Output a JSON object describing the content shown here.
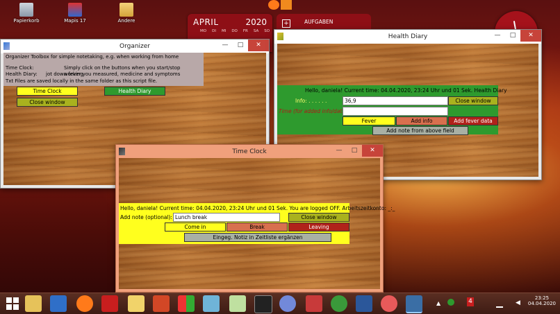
{
  "desktop": {
    "icons": [
      {
        "label": "Papierkorb"
      },
      {
        "label": "Mapis 17"
      },
      {
        "label": "Andere"
      }
    ],
    "calendar": {
      "month": "APRIL",
      "year": "2020",
      "days": [
        "MO",
        "DI",
        "MI",
        "DO",
        "FR",
        "SA",
        "SO"
      ]
    },
    "todo": {
      "label": "AUFGABEN",
      "plus": "+"
    }
  },
  "organizer": {
    "title": "Organizer",
    "controls": {
      "minimize": "—",
      "maximize": "□",
      "close": "✕"
    },
    "info": {
      "line1": "Organizer Toolbox for simple notetaking, e.g. when working from home",
      "line2_label": "Time Clock:",
      "line2_text": "Simply click on the buttons when you start/stop working.",
      "line3_label": "Health Diary:",
      "line3_text": "jot down fever you measured, medicine and symptoms",
      "line4": "Txt Files are saved locally in the same folder as this script file."
    },
    "buttons": {
      "time_clock": "Time Clock",
      "close_window": "Close window",
      "health_diary": "Health Diary"
    }
  },
  "health": {
    "title": "Health Diary",
    "controls": {
      "minimize": "—",
      "maximize": "□",
      "close": "✕"
    },
    "greeting": "Hello, daniela! Current time:  04.04.2020, 23:24 Uhr und 01 Sek. Health Diary",
    "info_label": "Info: . . . . . .",
    "info_value": "36,9",
    "time_label": "Time (for added info/data):",
    "time_value": "",
    "buttons": {
      "close_window": "Close window",
      "fever": "Fever",
      "add_info": "Add info",
      "add_fever_data": "Add fever data",
      "add_note": "Add note from above field"
    }
  },
  "timeclock": {
    "title": "Time Clock",
    "controls": {
      "minimize": "—",
      "maximize": "□",
      "close": "✕"
    },
    "greeting": "Hello, daniela! Current time:  04.04.2020, 23:24 Uhr und 01 Sek. You are logged OFF. Arbeitszeitkonto:  _:_",
    "note_label": "Add note (optional):",
    "note_value": "Lunch break",
    "buttons": {
      "close_window": "Close window",
      "come_in": "Come in",
      "break": "Break",
      "leaving": "Leaving",
      "add_note": "Eingeg. Notiz in Zeitliste ergänzen"
    }
  },
  "taskbar": {
    "time": "23:25",
    "date": "04.04.2020",
    "badge": "4"
  },
  "colors": {
    "yellow": "#ffff1e",
    "olive": "#a9b21e",
    "green": "#2e9a2e",
    "orange_red": "#d8704e",
    "dark_red": "#b0221a",
    "grey": "#a8b0a4",
    "organizer_info_bg": "#b8a8a8",
    "timeclock_frame": "#f0a07c"
  }
}
